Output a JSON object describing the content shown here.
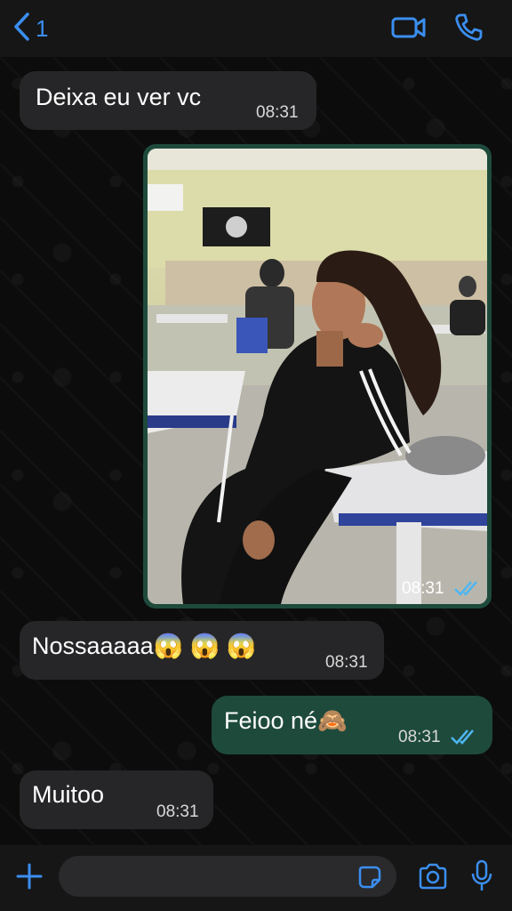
{
  "header": {
    "back_count": "1",
    "back_icon": "chevron-left-icon",
    "video_icon": "video-camera-icon",
    "call_icon": "phone-icon"
  },
  "messages": [
    {
      "direction": "incoming",
      "text": "Deixa eu ver vc",
      "time": "08:31"
    },
    {
      "direction": "outgoing",
      "type": "photo",
      "time": "08:31",
      "status": "read"
    },
    {
      "direction": "incoming",
      "text": "Nossaaaaa😱 😱 😱",
      "time": "08:31"
    },
    {
      "direction": "outgoing",
      "text": "Feioo né🙈",
      "time": "08:31",
      "status": "read"
    },
    {
      "direction": "incoming",
      "text": "Muitoo",
      "time": "08:31"
    }
  ],
  "composer": {
    "placeholder": "",
    "plus_icon": "plus-icon",
    "sticker_icon": "sticker-icon",
    "camera_icon": "camera-icon",
    "mic_icon": "microphone-icon"
  },
  "colors": {
    "accent": "#3b8ef0",
    "incoming_bubble": "#262628",
    "outgoing_bubble": "#1e4a3c",
    "read_ticks": "#4fb6f0"
  }
}
